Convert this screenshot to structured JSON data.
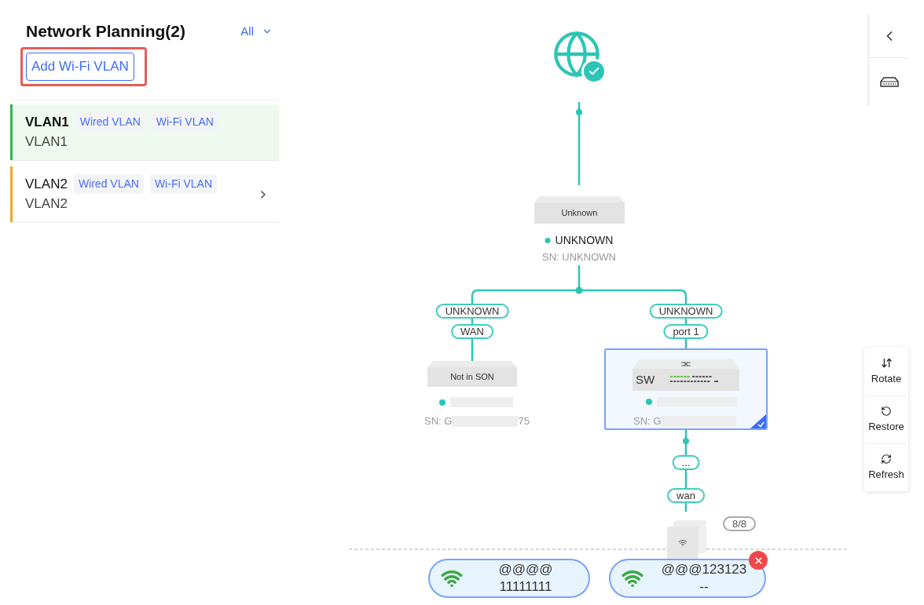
{
  "panel": {
    "title": "Network Planning(2)",
    "filter": "All",
    "add_button": "Add Wi-Fi VLAN",
    "add_button_highlighted": true
  },
  "vlans": [
    {
      "name": "VLAN1",
      "subtitle": "VLAN1",
      "tags": [
        "Wired VLAN",
        "Wi-Fi VLAN"
      ],
      "selected": true,
      "has_arrow": false,
      "color": "#2db84d"
    },
    {
      "name": "VLAN2",
      "subtitle": "VLAN2",
      "tags": [
        "Wired VLAN",
        "Wi-Fi VLAN"
      ],
      "selected": false,
      "has_arrow": true,
      "color": "#f5a623"
    }
  ],
  "internet": {
    "connected": true
  },
  "gateway": {
    "box_label": "Unknown",
    "name": "UNKNOWN",
    "sn": "SN: UNKNOWN"
  },
  "left_link": [
    "UNKNOWN",
    "WAN"
  ],
  "right_link": [
    "UNKNOWN",
    "port 1"
  ],
  "ap_device": {
    "box_label": "Not in SON",
    "sn": "SN: G",
    "sn_tail": "75"
  },
  "switch_device": {
    "box_label": "SW",
    "sn": "SN: G",
    "selected": true
  },
  "lower_link": [
    "...",
    "wan"
  ],
  "ap_count": "8/8",
  "ssids": [
    {
      "name": "@@@@",
      "password": "11111111",
      "removable": false
    },
    {
      "name": "@@@123123",
      "password": "--",
      "removable": true
    }
  ],
  "tools": [
    {
      "kind": "rotate",
      "label": "Rotate"
    },
    {
      "kind": "restore",
      "label": "Restore"
    },
    {
      "kind": "refresh",
      "label": "Refresh"
    }
  ]
}
